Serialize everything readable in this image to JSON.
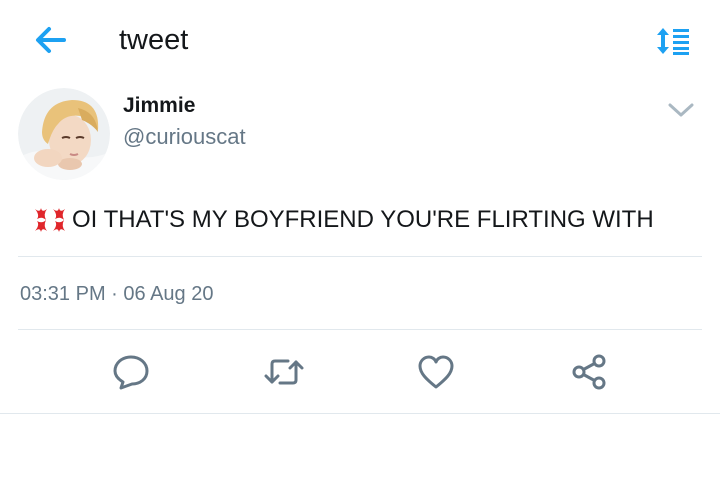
{
  "header": {
    "title": "tweet",
    "back_icon": "arrow-left-icon",
    "sort_icon": "sort-icon",
    "accent_color": "#1da1f2"
  },
  "tweet": {
    "author": {
      "name": "Jimmie",
      "handle": "@curiouscat",
      "avatar_icon": "user-avatar"
    },
    "text": "OI THAT'S MY BOYFRIEND YOU'RE FLIRTING WITH",
    "leading_emoji": "anger-symbol-emoji",
    "timestamp": "03:31 PM · 06 Aug 20",
    "text_color": "#14171a",
    "secondary_color": "#657786"
  },
  "actions": [
    {
      "icon": "reply-icon"
    },
    {
      "icon": "retweet-icon"
    },
    {
      "icon": "like-icon"
    },
    {
      "icon": "share-icon"
    }
  ],
  "colors": {
    "emoji_red": "#e0262b",
    "icon_gray": "#657786",
    "divider": "#e1e8ed"
  }
}
